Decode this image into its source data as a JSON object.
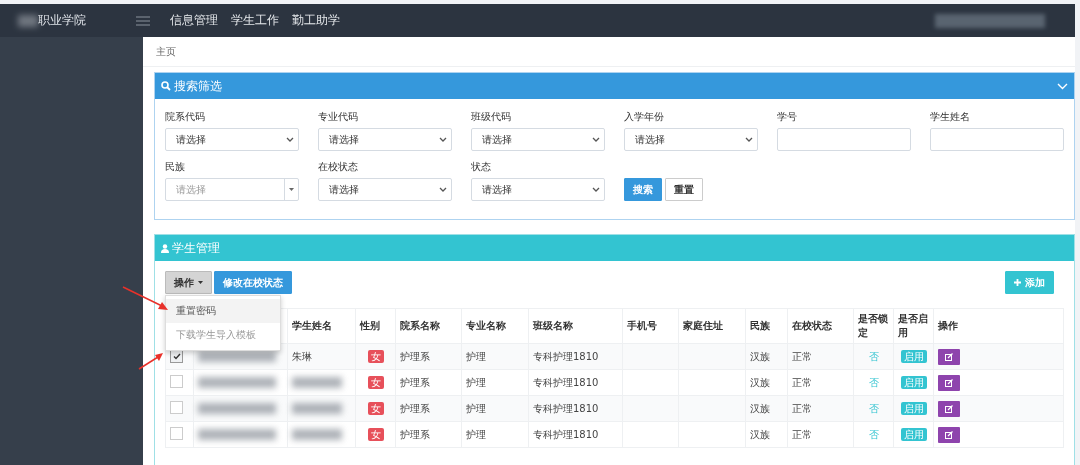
{
  "brand": "职业学院",
  "nav": [
    "信息管理",
    "学生工作",
    "勤工助学"
  ],
  "breadcrumb": "主页",
  "search_panel": {
    "title": "搜索筛选",
    "fields": [
      {
        "label": "院系代码",
        "kind": "select",
        "value": "请选择"
      },
      {
        "label": "专业代码",
        "kind": "select",
        "value": "请选择"
      },
      {
        "label": "班级代码",
        "kind": "select",
        "value": "请选择"
      },
      {
        "label": "入学年份",
        "kind": "select",
        "value": "请选择"
      },
      {
        "label": "学号",
        "kind": "text"
      },
      {
        "label": "学生姓名",
        "kind": "text"
      },
      {
        "label": "民族",
        "kind": "combo",
        "placeholder": "请选择"
      },
      {
        "label": "在校状态",
        "kind": "select",
        "value": "请选择"
      },
      {
        "label": "状态",
        "kind": "select",
        "value": "请选择"
      }
    ],
    "search_button": "搜索",
    "reset_button": "重置"
  },
  "student_panel": {
    "title": "学生管理",
    "actions": {
      "label": "操作",
      "expanded": true,
      "items": [
        {
          "label": "重置密码",
          "selected": true
        },
        {
          "label": "下载学生导入模板",
          "selected": false
        }
      ]
    },
    "status_button": "修改在校状态",
    "add_button": "添加",
    "columns": [
      "学生姓名",
      "性别",
      "院系名称",
      "专业名称",
      "班级名称",
      "手机号",
      "家庭住址",
      "民族",
      "在校状态",
      "是否锁定",
      "是否启用",
      "操作"
    ],
    "rows": [
      {
        "checked": true,
        "name": "朱琳",
        "gender": "女",
        "dept": "护理系",
        "major": "护理",
        "class": "专科护理1810",
        "ethnicity": "汉族",
        "status": "正常",
        "locked": "否",
        "enabled": "启用"
      },
      {
        "checked": false,
        "gender": "女",
        "dept": "护理系",
        "major": "护理",
        "class": "专科护理1810",
        "ethnicity": "汉族",
        "status": "正常",
        "locked": "否",
        "enabled": "启用"
      },
      {
        "checked": false,
        "gender": "女",
        "dept": "护理系",
        "major": "护理",
        "class": "专科护理1810",
        "ethnicity": "汉族",
        "status": "正常",
        "locked": "否",
        "enabled": "启用"
      },
      {
        "checked": false,
        "gender": "女",
        "dept": "护理系",
        "major": "护理",
        "class": "专科护理1810",
        "ethnicity": "汉族",
        "status": "正常",
        "locked": "否",
        "enabled": "启用"
      }
    ]
  }
}
